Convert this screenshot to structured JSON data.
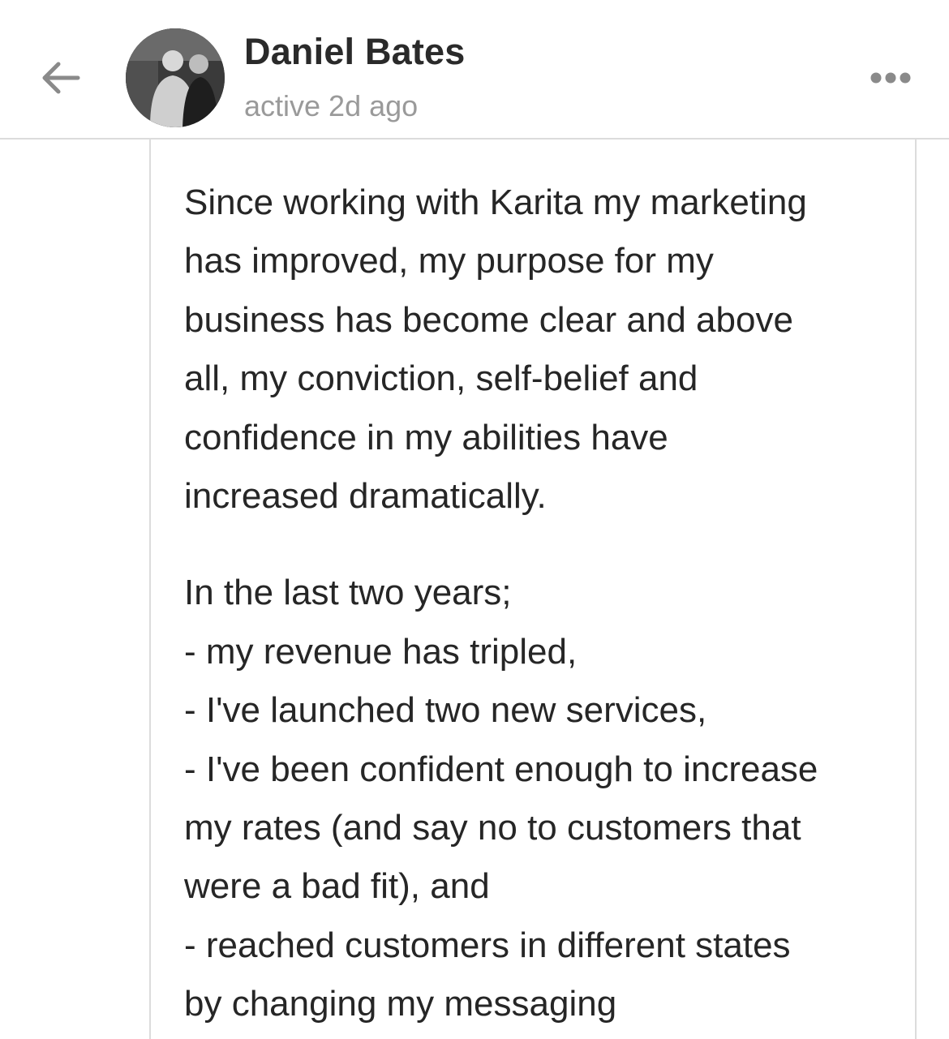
{
  "header": {
    "name": "Daniel Bates",
    "status": "active 2d ago",
    "back_icon": "arrow-left-icon",
    "more_icon": "more-horizontal-icon"
  },
  "message": {
    "paragraph1": [
      "Since working with Karita my marketing",
      "has improved, my purpose for my",
      "business has become clear and above",
      "all, my conviction, self-belief and",
      "confidence in my abilities have",
      "increased dramatically."
    ],
    "paragraph2": [
      "In the last two years;",
      "- my revenue has tripled,",
      "- I've launched two new services,",
      "- I've been confident enough to increase",
      "my rates (and say no to customers that",
      "were a bad fit), and",
      "- reached customers in different states",
      "by changing my messaging"
    ]
  },
  "colors": {
    "name": "#2a2a2a",
    "status": "#9a9a9a",
    "divider": "#dcdcdc",
    "icon": "#8a8a8a"
  }
}
